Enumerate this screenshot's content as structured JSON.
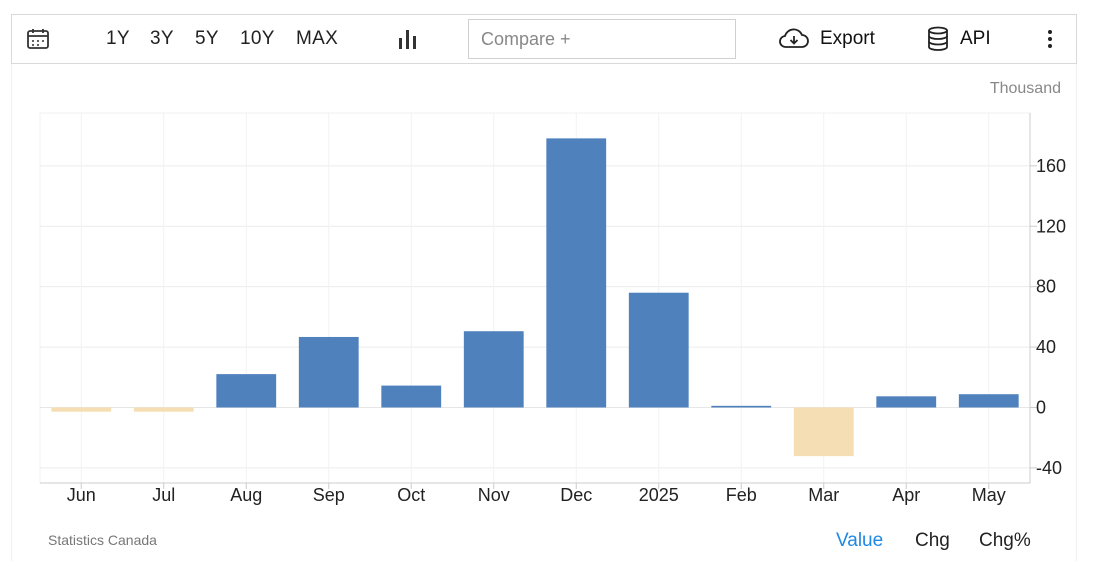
{
  "toolbar": {
    "ranges": [
      "1Y",
      "3Y",
      "5Y",
      "10Y",
      "MAX"
    ],
    "compare_placeholder": "Compare +",
    "export_label": "Export",
    "api_label": "API",
    "icons": [
      "calendar-icon",
      "bar-chart-icon",
      "cloud-download-icon",
      "database-icon",
      "more-vertical-icon"
    ]
  },
  "footer": {
    "source": "Statistics Canada",
    "modes": [
      "Value",
      "Chg",
      "Chg%"
    ],
    "active_mode": "Value"
  },
  "colors": {
    "positive": "#4f81bd",
    "negative": "#f5deb3",
    "active_mode": "#1e88e5"
  },
  "chart_data": {
    "type": "bar",
    "unit_label": "Thousand",
    "categories": [
      "Jun",
      "Jul",
      "Aug",
      "Sep",
      "Oct",
      "Nov",
      "Dec",
      "2025",
      "Feb",
      "Mar",
      "Apr",
      "May"
    ],
    "values": [
      -2.8,
      -2.8,
      22.1,
      46.7,
      14.5,
      50.5,
      178.2,
      76.0,
      1.1,
      -32.2,
      7.4,
      8.8
    ],
    "ylim": [
      -50,
      195
    ],
    "yticks": [
      -40,
      0,
      40,
      80,
      120,
      160
    ],
    "grid": true,
    "y_axis_position": "right"
  }
}
